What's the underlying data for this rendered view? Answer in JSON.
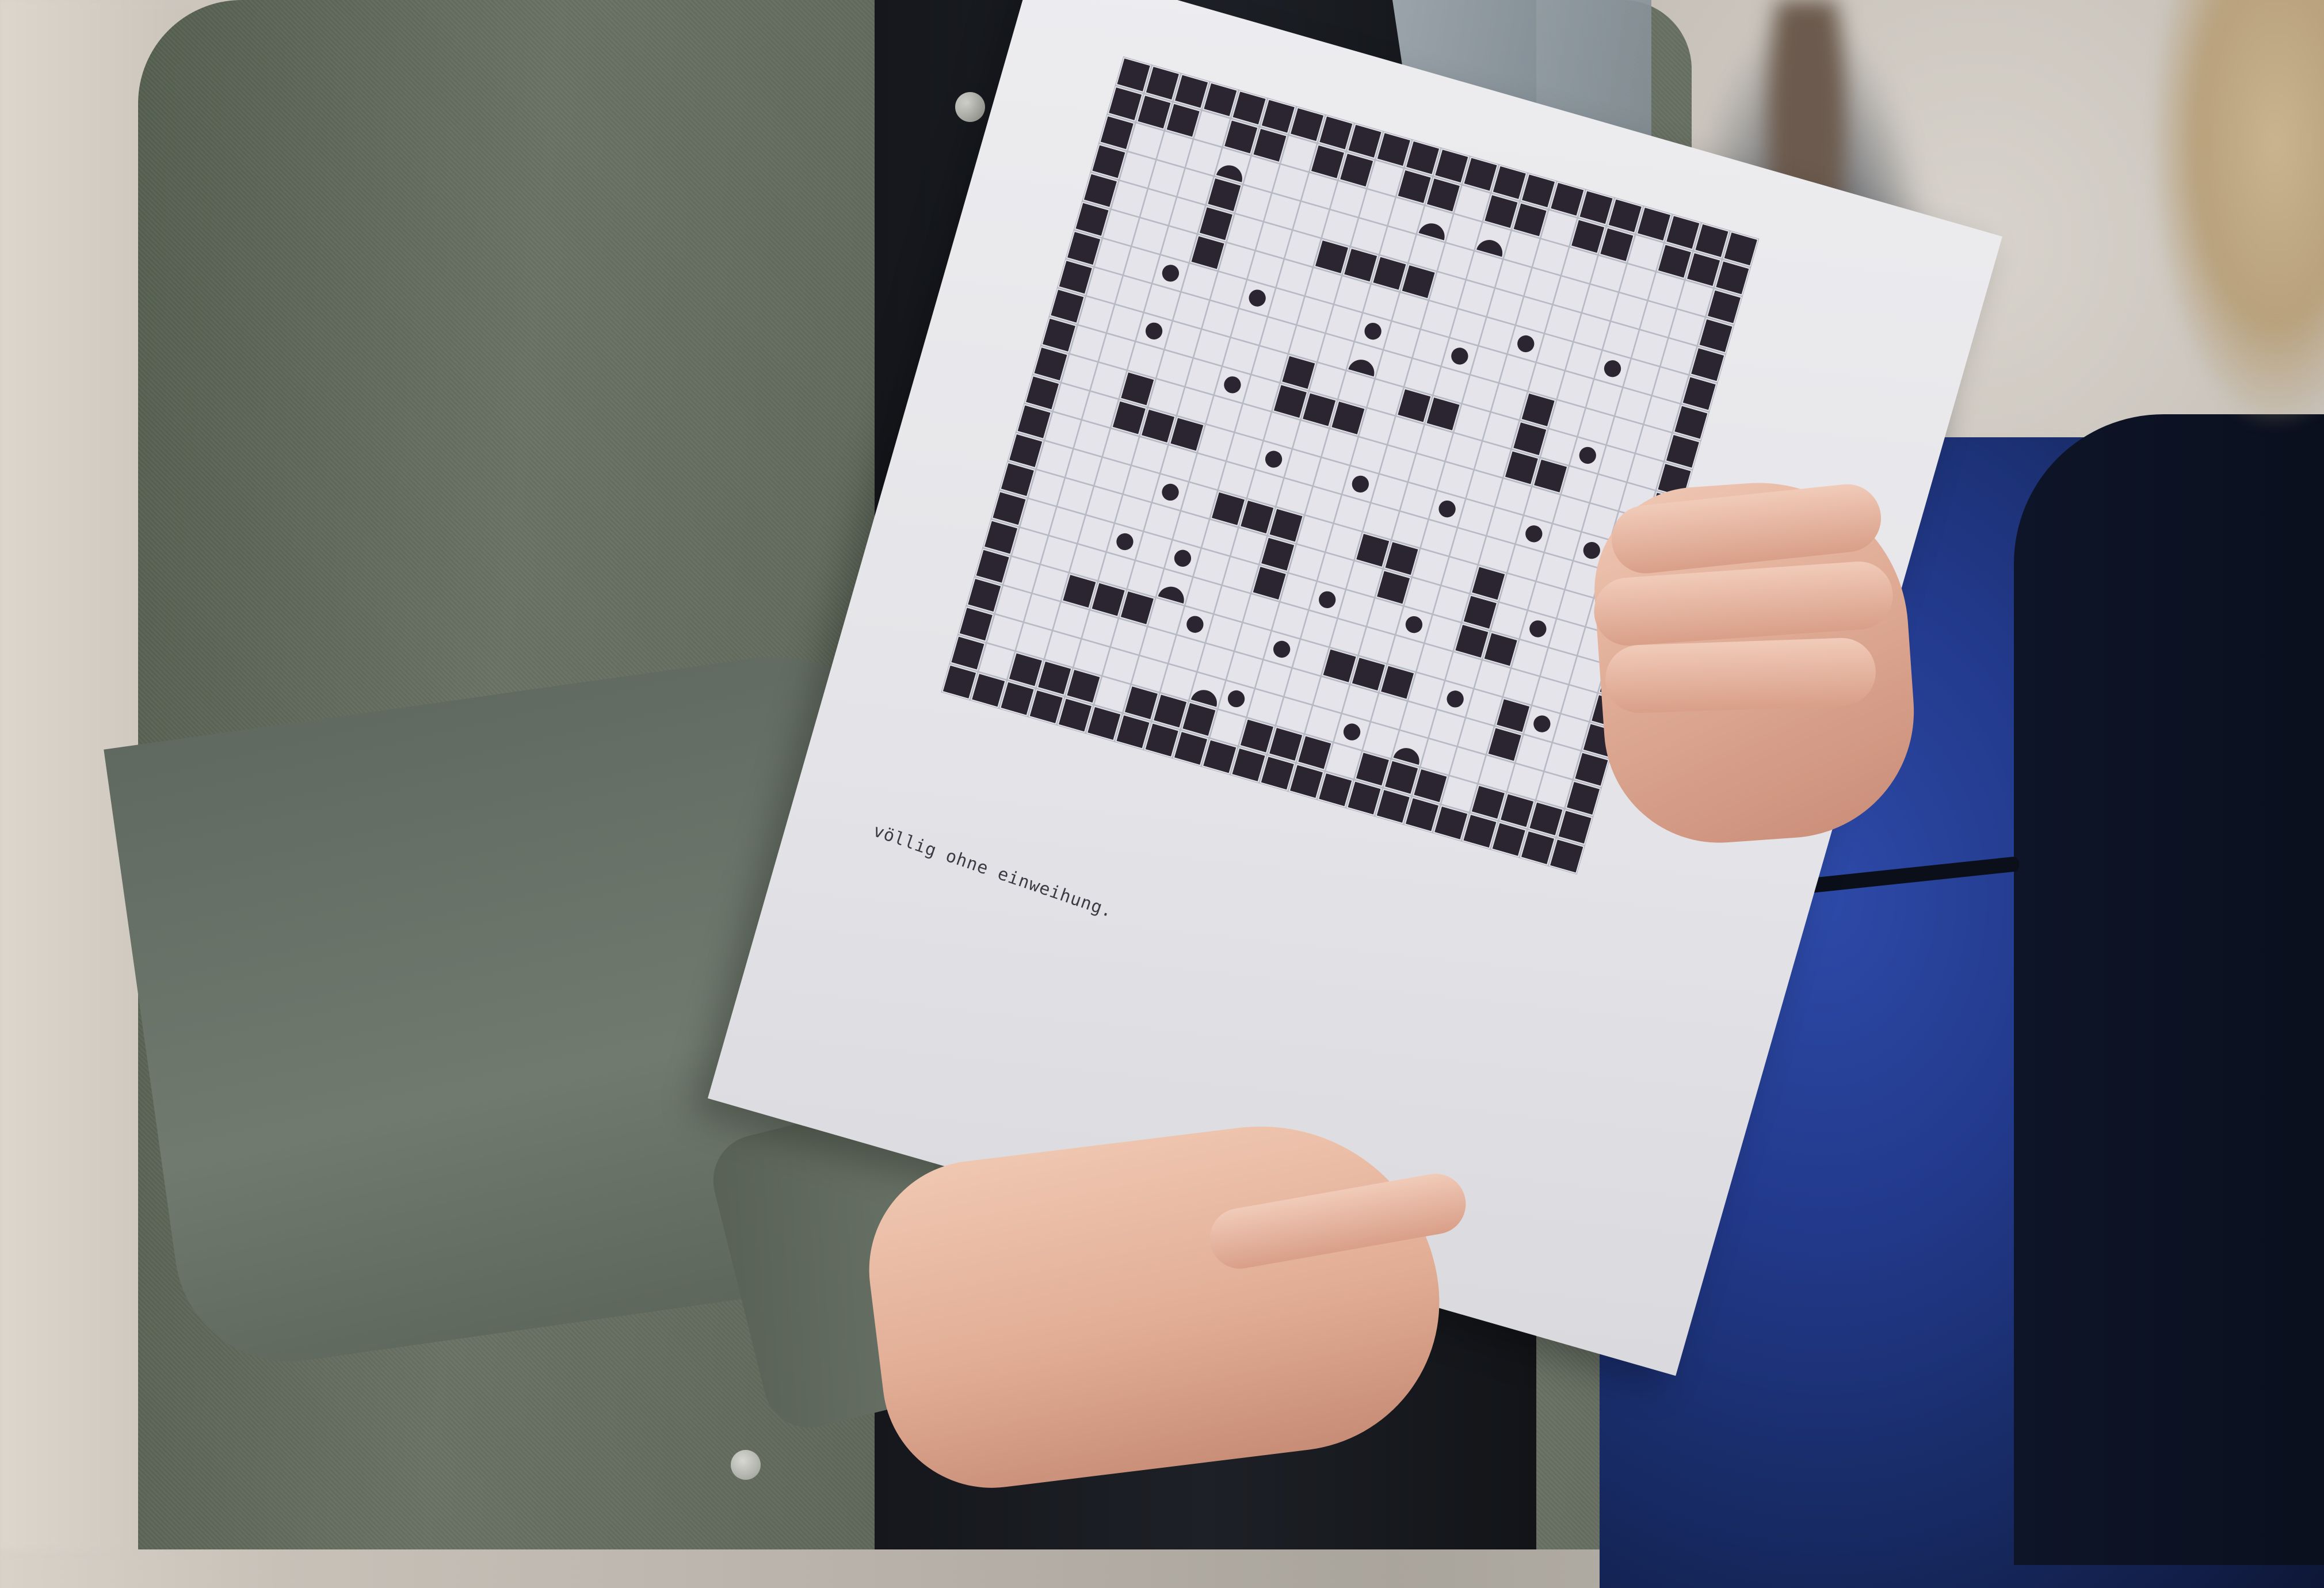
{
  "scene": {
    "description_items": [
      "person holding printed poster",
      "background person",
      "blue jacket"
    ]
  },
  "poster": {
    "caption": "völlig ohne einweihung.",
    "colors": {
      "ink": "#2a2530",
      "grid_line": "#b7b9c4",
      "paper": "#e4e4ea"
    }
  },
  "icons": [
    "circle-icon",
    "half-circle-icon"
  ]
}
